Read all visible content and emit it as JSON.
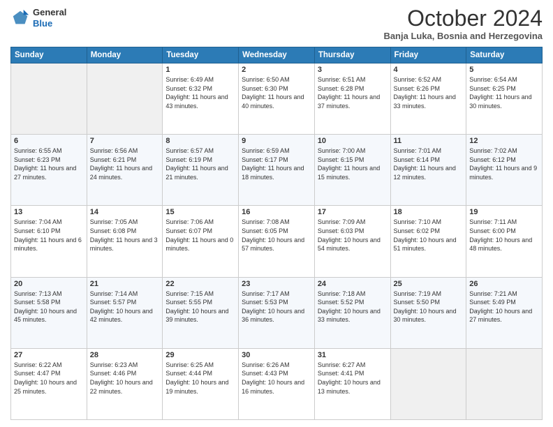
{
  "header": {
    "logo_line1": "General",
    "logo_line2": "Blue",
    "month": "October 2024",
    "location": "Banja Luka, Bosnia and Herzegovina"
  },
  "weekdays": [
    "Sunday",
    "Monday",
    "Tuesday",
    "Wednesday",
    "Thursday",
    "Friday",
    "Saturday"
  ],
  "weeks": [
    [
      {
        "day": "",
        "info": ""
      },
      {
        "day": "",
        "info": ""
      },
      {
        "day": "1",
        "info": "Sunrise: 6:49 AM\nSunset: 6:32 PM\nDaylight: 11 hours and 43 minutes."
      },
      {
        "day": "2",
        "info": "Sunrise: 6:50 AM\nSunset: 6:30 PM\nDaylight: 11 hours and 40 minutes."
      },
      {
        "day": "3",
        "info": "Sunrise: 6:51 AM\nSunset: 6:28 PM\nDaylight: 11 hours and 37 minutes."
      },
      {
        "day": "4",
        "info": "Sunrise: 6:52 AM\nSunset: 6:26 PM\nDaylight: 11 hours and 33 minutes."
      },
      {
        "day": "5",
        "info": "Sunrise: 6:54 AM\nSunset: 6:25 PM\nDaylight: 11 hours and 30 minutes."
      }
    ],
    [
      {
        "day": "6",
        "info": "Sunrise: 6:55 AM\nSunset: 6:23 PM\nDaylight: 11 hours and 27 minutes."
      },
      {
        "day": "7",
        "info": "Sunrise: 6:56 AM\nSunset: 6:21 PM\nDaylight: 11 hours and 24 minutes."
      },
      {
        "day": "8",
        "info": "Sunrise: 6:57 AM\nSunset: 6:19 PM\nDaylight: 11 hours and 21 minutes."
      },
      {
        "day": "9",
        "info": "Sunrise: 6:59 AM\nSunset: 6:17 PM\nDaylight: 11 hours and 18 minutes."
      },
      {
        "day": "10",
        "info": "Sunrise: 7:00 AM\nSunset: 6:15 PM\nDaylight: 11 hours and 15 minutes."
      },
      {
        "day": "11",
        "info": "Sunrise: 7:01 AM\nSunset: 6:14 PM\nDaylight: 11 hours and 12 minutes."
      },
      {
        "day": "12",
        "info": "Sunrise: 7:02 AM\nSunset: 6:12 PM\nDaylight: 11 hours and 9 minutes."
      }
    ],
    [
      {
        "day": "13",
        "info": "Sunrise: 7:04 AM\nSunset: 6:10 PM\nDaylight: 11 hours and 6 minutes."
      },
      {
        "day": "14",
        "info": "Sunrise: 7:05 AM\nSunset: 6:08 PM\nDaylight: 11 hours and 3 minutes."
      },
      {
        "day": "15",
        "info": "Sunrise: 7:06 AM\nSunset: 6:07 PM\nDaylight: 11 hours and 0 minutes."
      },
      {
        "day": "16",
        "info": "Sunrise: 7:08 AM\nSunset: 6:05 PM\nDaylight: 10 hours and 57 minutes."
      },
      {
        "day": "17",
        "info": "Sunrise: 7:09 AM\nSunset: 6:03 PM\nDaylight: 10 hours and 54 minutes."
      },
      {
        "day": "18",
        "info": "Sunrise: 7:10 AM\nSunset: 6:02 PM\nDaylight: 10 hours and 51 minutes."
      },
      {
        "day": "19",
        "info": "Sunrise: 7:11 AM\nSunset: 6:00 PM\nDaylight: 10 hours and 48 minutes."
      }
    ],
    [
      {
        "day": "20",
        "info": "Sunrise: 7:13 AM\nSunset: 5:58 PM\nDaylight: 10 hours and 45 minutes."
      },
      {
        "day": "21",
        "info": "Sunrise: 7:14 AM\nSunset: 5:57 PM\nDaylight: 10 hours and 42 minutes."
      },
      {
        "day": "22",
        "info": "Sunrise: 7:15 AM\nSunset: 5:55 PM\nDaylight: 10 hours and 39 minutes."
      },
      {
        "day": "23",
        "info": "Sunrise: 7:17 AM\nSunset: 5:53 PM\nDaylight: 10 hours and 36 minutes."
      },
      {
        "day": "24",
        "info": "Sunrise: 7:18 AM\nSunset: 5:52 PM\nDaylight: 10 hours and 33 minutes."
      },
      {
        "day": "25",
        "info": "Sunrise: 7:19 AM\nSunset: 5:50 PM\nDaylight: 10 hours and 30 minutes."
      },
      {
        "day": "26",
        "info": "Sunrise: 7:21 AM\nSunset: 5:49 PM\nDaylight: 10 hours and 27 minutes."
      }
    ],
    [
      {
        "day": "27",
        "info": "Sunrise: 6:22 AM\nSunset: 4:47 PM\nDaylight: 10 hours and 25 minutes."
      },
      {
        "day": "28",
        "info": "Sunrise: 6:23 AM\nSunset: 4:46 PM\nDaylight: 10 hours and 22 minutes."
      },
      {
        "day": "29",
        "info": "Sunrise: 6:25 AM\nSunset: 4:44 PM\nDaylight: 10 hours and 19 minutes."
      },
      {
        "day": "30",
        "info": "Sunrise: 6:26 AM\nSunset: 4:43 PM\nDaylight: 10 hours and 16 minutes."
      },
      {
        "day": "31",
        "info": "Sunrise: 6:27 AM\nSunset: 4:41 PM\nDaylight: 10 hours and 13 minutes."
      },
      {
        "day": "",
        "info": ""
      },
      {
        "day": "",
        "info": ""
      }
    ]
  ]
}
